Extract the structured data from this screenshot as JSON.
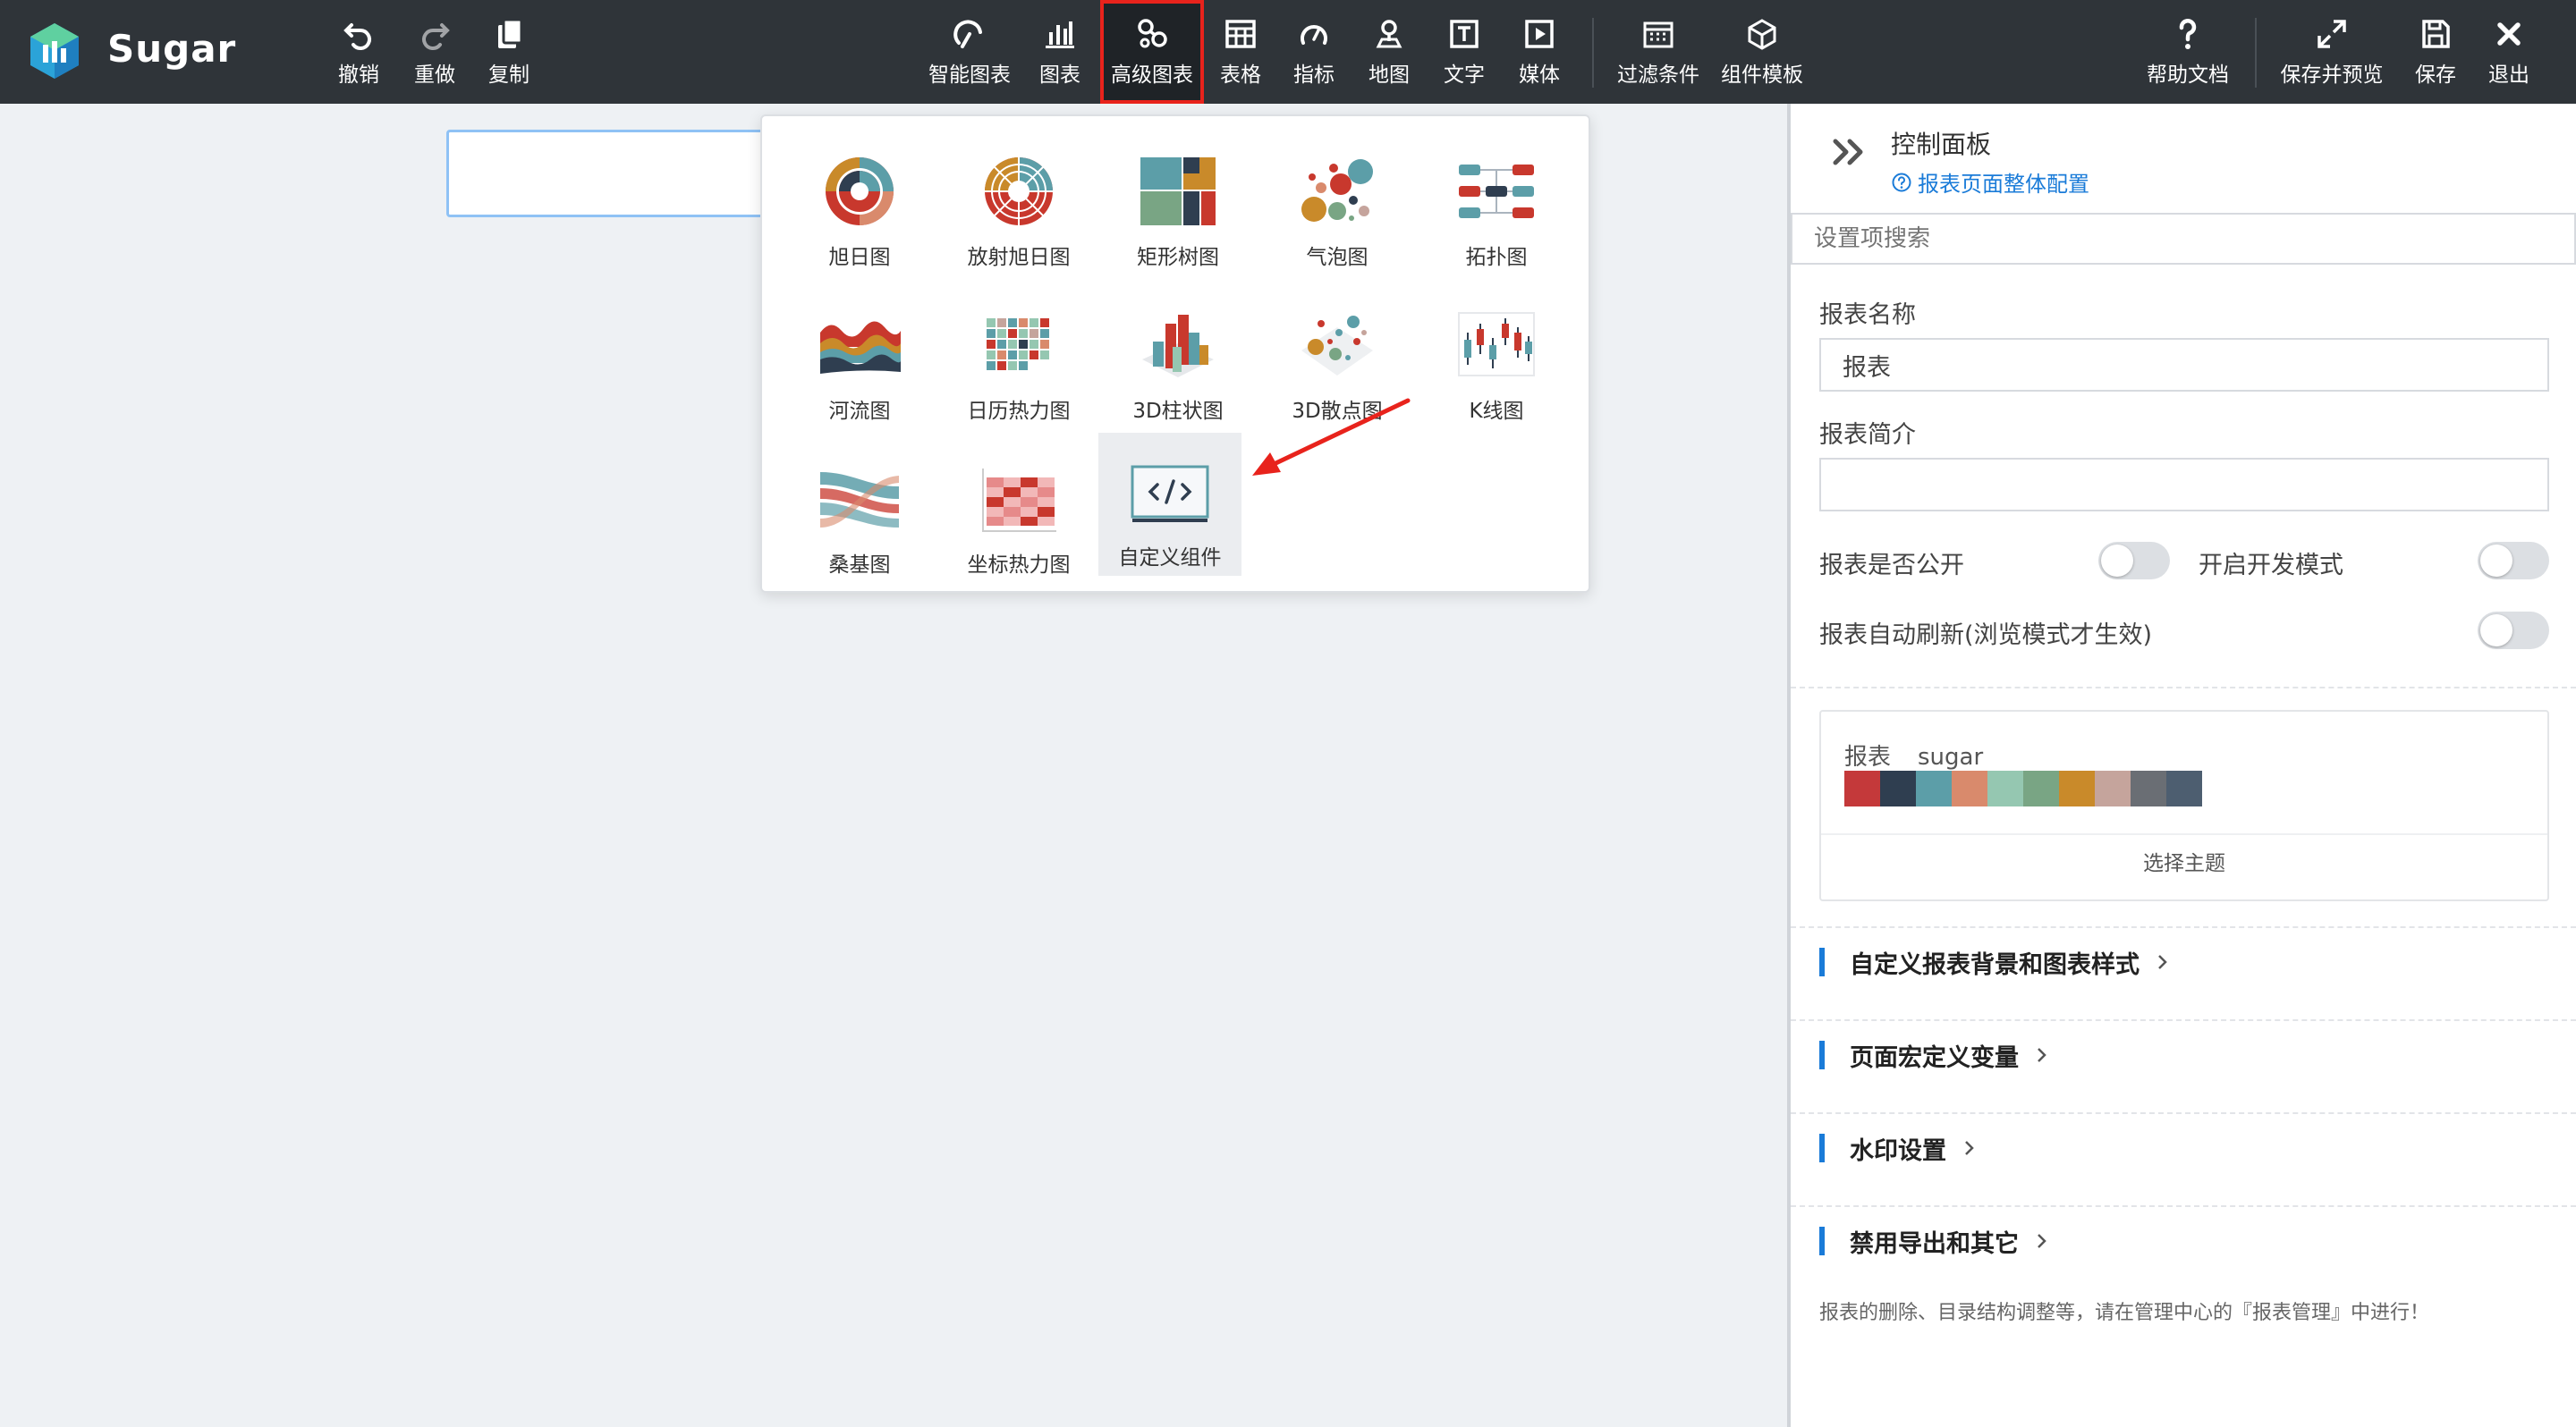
{
  "app": {
    "title": "Sugar"
  },
  "toolbar": {
    "undo": "撤销",
    "redo": "重做",
    "copy": "复制",
    "smart_chart": "智能图表",
    "chart": "图表",
    "advanced_chart": "高级图表",
    "table": "表格",
    "metric": "指标",
    "map": "地图",
    "text": "文字",
    "media": "媒体",
    "filter": "过滤条件",
    "component_template": "组件模板",
    "help": "帮助文档",
    "save_preview": "保存并预览",
    "save": "保存",
    "exit": "退出"
  },
  "advanced_charts": {
    "items": [
      {
        "label": "旭日图",
        "icon": "sunburst-icon"
      },
      {
        "label": "放射旭日图",
        "icon": "radial-sunburst-icon"
      },
      {
        "label": "矩形树图",
        "icon": "treemap-icon"
      },
      {
        "label": "气泡图",
        "icon": "bubble-icon"
      },
      {
        "label": "拓扑图",
        "icon": "topology-icon"
      },
      {
        "label": "河流图",
        "icon": "river-icon"
      },
      {
        "label": "日历热力图",
        "icon": "calendar-heatmap-icon"
      },
      {
        "label": "3D柱状图",
        "icon": "bar-3d-icon"
      },
      {
        "label": "3D散点图",
        "icon": "scatter-3d-icon"
      },
      {
        "label": "K线图",
        "icon": "candlestick-icon"
      },
      {
        "label": "桑基图",
        "icon": "sankey-icon"
      },
      {
        "label": "坐标热力图",
        "icon": "heatmap-icon"
      },
      {
        "label": "自定义组件",
        "icon": "code-icon"
      }
    ]
  },
  "panel": {
    "title": "控制面板",
    "config_link": "报表页面整体配置",
    "search_placeholder": "设置项搜索",
    "report_name_label": "报表名称",
    "report_name_value": "报表",
    "report_desc_label": "报表简介",
    "report_desc_value": "",
    "public_label": "报表是否公开",
    "dev_mode_label": "开启开发模式",
    "auto_refresh_label": "报表自动刷新(浏览模式才生效)",
    "theme": {
      "name_prefix": "报表",
      "name": "sugar",
      "colors": [
        "#c4393a",
        "#2f3e50",
        "#5c9ea8",
        "#d98a6c",
        "#95c7b1",
        "#79a584",
        "#c98a2a",
        "#c5a49c",
        "#6a6e74",
        "#4d5e70"
      ],
      "choose_label": "选择主题"
    },
    "sections": [
      "自定义报表背景和图表样式",
      "页面宏定义变量",
      "水印设置",
      "禁用导出和其它"
    ],
    "footnote": "报表的删除、目录结构调整等，请在管理中心的『报表管理』中进行！"
  },
  "colors": {
    "topbar": "#2f3439",
    "accent": "#1a7bd8",
    "highlight_border": "#e8231c"
  }
}
